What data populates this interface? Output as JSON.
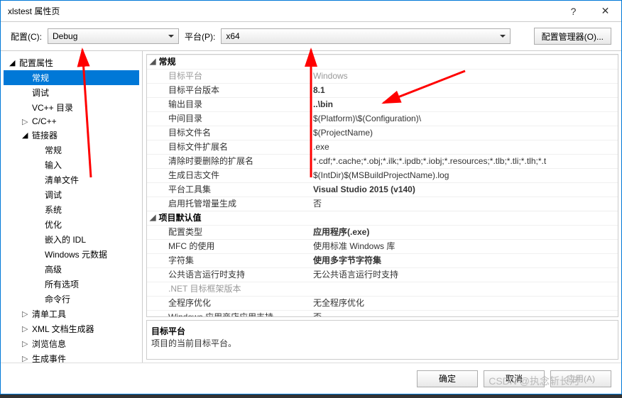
{
  "window": {
    "title": "xlstest 属性页",
    "help": "?",
    "close": "✕"
  },
  "toolbar": {
    "config_label": "配置(C):",
    "config_value": "Debug",
    "platform_label": "平台(P):",
    "platform_value": "x64",
    "cfg_mgr": "配置管理器(O)..."
  },
  "tree": {
    "items": [
      {
        "label": "配置属性",
        "lvl": 0,
        "exp": "open"
      },
      {
        "label": "常规",
        "lvl": 1,
        "sel": true
      },
      {
        "label": "调试",
        "lvl": 1
      },
      {
        "label": "VC++ 目录",
        "lvl": 1
      },
      {
        "label": "C/C++",
        "lvl": 1,
        "exp": "closed"
      },
      {
        "label": "链接器",
        "lvl": 1,
        "exp": "open"
      },
      {
        "label": "常规",
        "lvl": 2
      },
      {
        "label": "输入",
        "lvl": 2
      },
      {
        "label": "清单文件",
        "lvl": 2
      },
      {
        "label": "调试",
        "lvl": 2
      },
      {
        "label": "系统",
        "lvl": 2
      },
      {
        "label": "优化",
        "lvl": 2
      },
      {
        "label": "嵌入的 IDL",
        "lvl": 2
      },
      {
        "label": "Windows 元数据",
        "lvl": 2
      },
      {
        "label": "高级",
        "lvl": 2
      },
      {
        "label": "所有选项",
        "lvl": 2
      },
      {
        "label": "命令行",
        "lvl": 2
      },
      {
        "label": "清单工具",
        "lvl": 1,
        "exp": "closed"
      },
      {
        "label": "XML 文档生成器",
        "lvl": 1,
        "exp": "closed"
      },
      {
        "label": "浏览信息",
        "lvl": 1,
        "exp": "closed"
      },
      {
        "label": "生成事件",
        "lvl": 1,
        "exp": "closed"
      }
    ]
  },
  "grid": {
    "cat1": "常规",
    "rows1": [
      {
        "name": "目标平台",
        "val": "Windows",
        "dim": true
      },
      {
        "name": "目标平台版本",
        "val": "8.1",
        "bold": true
      },
      {
        "name": "输出目录",
        "val": "..\\bin",
        "bold": true
      },
      {
        "name": "中间目录",
        "val": "$(Platform)\\$(Configuration)\\"
      },
      {
        "name": "目标文件名",
        "val": "$(ProjectName)"
      },
      {
        "name": "目标文件扩展名",
        "val": ".exe"
      },
      {
        "name": "清除时要删除的扩展名",
        "val": "*.cdf;*.cache;*.obj;*.ilk;*.ipdb;*.iobj;*.resources;*.tlb;*.tli;*.tlh;*.t"
      },
      {
        "name": "生成日志文件",
        "val": "$(IntDir)$(MSBuildProjectName).log"
      },
      {
        "name": "平台工具集",
        "val": "Visual Studio 2015 (v140)",
        "bold": true
      },
      {
        "name": "启用托管增量生成",
        "val": "否"
      }
    ],
    "cat2": "项目默认值",
    "rows2": [
      {
        "name": "配置类型",
        "val": "应用程序(.exe)",
        "bold": true
      },
      {
        "name": "MFC 的使用",
        "val": "使用标准 Windows 库"
      },
      {
        "name": "字符集",
        "val": "使用多字节字符集",
        "bold": true
      },
      {
        "name": "公共语言运行时支持",
        "val": "无公共语言运行时支持"
      },
      {
        "name": ".NET 目标框架版本",
        "val": "",
        "dim": true
      },
      {
        "name": "全程序优化",
        "val": "无全程序优化"
      },
      {
        "name": "Windows 应用商店应用支持",
        "val": "否"
      }
    ]
  },
  "desc": {
    "title": "目标平台",
    "body": "项目的当前目标平台。"
  },
  "footer": {
    "ok": "确定",
    "cancel": "取消",
    "apply": "应用(A)"
  },
  "watermark": "CSDN @执念斩长河"
}
